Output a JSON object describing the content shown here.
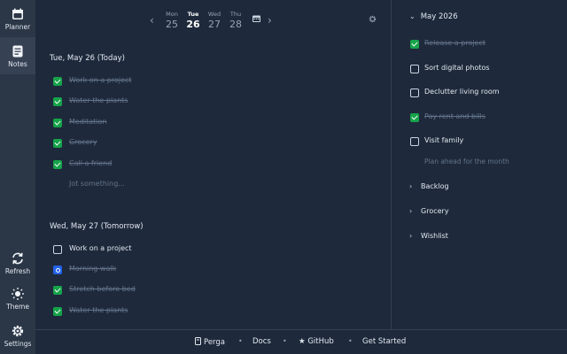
{
  "sidebar": {
    "items": [
      {
        "label": "Planner"
      },
      {
        "label": "Notes"
      },
      {
        "label": "Refresh"
      },
      {
        "label": "Theme"
      },
      {
        "label": "Settings"
      }
    ]
  },
  "daynav": {
    "days": [
      {
        "name": "Mon",
        "date": "25"
      },
      {
        "name": "Tue",
        "date": "26"
      },
      {
        "name": "Wed",
        "date": "27"
      },
      {
        "name": "Thu",
        "date": "28"
      }
    ]
  },
  "today": {
    "heading": "Tue, May 26 (Today)",
    "tasks": [
      {
        "label": "Work on a project",
        "done": true
      },
      {
        "label": "Water the plants",
        "done": true
      },
      {
        "label": "Meditation",
        "done": true
      },
      {
        "label": "Grocery",
        "done": true
      },
      {
        "label": "Call a friend",
        "done": true
      }
    ],
    "placeholder": "Jot something..."
  },
  "tomorrow": {
    "heading": "Wed, May 27 (Tomorrow)",
    "tasks": [
      {
        "label": "Work on a project",
        "done": false
      },
      {
        "label": "Morning walk",
        "done": true
      },
      {
        "label": "Stretch before bed",
        "done": true
      },
      {
        "label": "Water the plants",
        "done": true
      }
    ]
  },
  "month": {
    "heading": "May 2026",
    "tasks": [
      {
        "label": "Release a project",
        "done": true
      },
      {
        "label": "Sort digital photos",
        "done": false
      },
      {
        "label": "Declutter living room",
        "done": false
      },
      {
        "label": "Pay rent and bills",
        "done": true
      },
      {
        "label": "Visit family",
        "done": false
      }
    ],
    "placeholder": "Plan ahead for the month"
  },
  "groups": [
    "Backlog",
    "Grocery",
    "Wishlist"
  ],
  "footer": {
    "brand": "Perga",
    "docs": "Docs",
    "github": "GitHub",
    "start": "Get Started"
  },
  "colors": {
    "background": "#1e293b",
    "sidebar": "#2b3646",
    "check": "#16a34a",
    "accent": "#2563eb"
  }
}
